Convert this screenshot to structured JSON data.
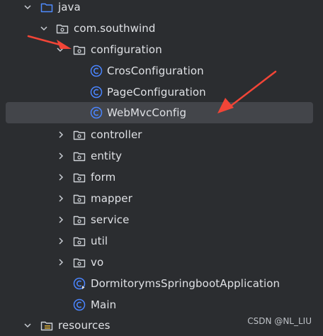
{
  "tree": {
    "rows": [
      {
        "label": "java",
        "icon": "folder-source-icon",
        "expanded": true,
        "chevron": "down"
      },
      {
        "label": "com.southwind",
        "icon": "package-icon",
        "expanded": true,
        "chevron": "down"
      },
      {
        "label": "configuration",
        "icon": "package-icon",
        "expanded": true,
        "chevron": "down"
      },
      {
        "label": "CrosConfiguration",
        "icon": "class-icon"
      },
      {
        "label": "PageConfiguration",
        "icon": "class-icon"
      },
      {
        "label": "WebMvcConfig",
        "icon": "class-icon",
        "selected": true
      },
      {
        "label": "controller",
        "icon": "package-icon",
        "expanded": false,
        "chevron": "right"
      },
      {
        "label": "entity",
        "icon": "package-icon",
        "expanded": false,
        "chevron": "right"
      },
      {
        "label": "form",
        "icon": "package-icon",
        "expanded": false,
        "chevron": "right"
      },
      {
        "label": "mapper",
        "icon": "package-icon",
        "expanded": false,
        "chevron": "right"
      },
      {
        "label": "service",
        "icon": "package-icon",
        "expanded": false,
        "chevron": "right"
      },
      {
        "label": "util",
        "icon": "package-icon",
        "expanded": false,
        "chevron": "right"
      },
      {
        "label": "vo",
        "icon": "package-icon",
        "expanded": false,
        "chevron": "right"
      },
      {
        "label": "DormitorymsSpringbootApplication",
        "icon": "spring-class-icon"
      },
      {
        "label": "Main",
        "icon": "class-icon"
      },
      {
        "label": "resources",
        "icon": "resources-folder-icon",
        "expanded": true,
        "chevron": "down"
      }
    ]
  },
  "watermark": "CSDN @NL_LIU",
  "colors": {
    "background": "#2b2d30",
    "selected_row": "#43454a",
    "text": "#dfe1e5",
    "class_icon": "#4a85ff",
    "arrow": "#f24537"
  }
}
